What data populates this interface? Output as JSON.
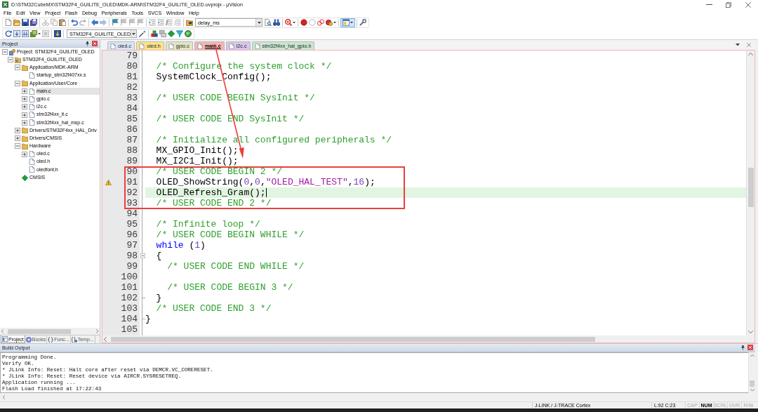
{
  "window": {
    "title": "D:\\STM32CubeMX\\STM32F4_GUILITE_OLED\\MDK-ARM\\STM32F4_GUILITE_OLED.uvprojx - µVision"
  },
  "menu": [
    "File",
    "Edit",
    "View",
    "Project",
    "Flash",
    "Debug",
    "Peripherals",
    "Tools",
    "SVCS",
    "Window",
    "Help"
  ],
  "toolbar": {
    "find_field": {
      "value": "delay_ms"
    },
    "target_select": {
      "value": "STM32F4_GUILITE_OLED"
    }
  },
  "project_panel": {
    "title": "Project",
    "tree": [
      {
        "label": "Project: STM32F4_GUILITE_OLED",
        "kind": "project",
        "expanded": true,
        "selected": false,
        "children": [
          {
            "label": "STM32F4_GUILITE_OLED",
            "kind": "target",
            "expanded": true,
            "selected": false,
            "children": [
              {
                "label": "Application/MDK-ARM",
                "kind": "group",
                "expanded": true,
                "selected": false,
                "children": [
                  {
                    "label": "startup_stm32f407xx.s",
                    "kind": "file",
                    "selected": false
                  }
                ]
              },
              {
                "label": "Application/User/Core",
                "kind": "group",
                "expanded": true,
                "selected": false,
                "children": [
                  {
                    "label": "main.c",
                    "kind": "file",
                    "expanded": false,
                    "selected": true
                  },
                  {
                    "label": "gpio.c",
                    "kind": "file",
                    "expanded": false,
                    "selected": false
                  },
                  {
                    "label": "i2c.c",
                    "kind": "file",
                    "expanded": false,
                    "selected": false
                  },
                  {
                    "label": "stm32f4xx_it.c",
                    "kind": "file",
                    "expanded": false,
                    "selected": false
                  },
                  {
                    "label": "stm32f4xx_hal_msp.c",
                    "kind": "file",
                    "expanded": false,
                    "selected": false
                  }
                ]
              },
              {
                "label": "Drivers/STM32F4xx_HAL_Driv",
                "kind": "group",
                "expanded": false,
                "selected": false
              },
              {
                "label": "Drivers/CMSIS",
                "kind": "group",
                "expanded": false,
                "selected": false
              },
              {
                "label": "Hardware",
                "kind": "group",
                "expanded": true,
                "selected": false,
                "children": [
                  {
                    "label": "oled.c",
                    "kind": "file",
                    "expanded": false,
                    "selected": false
                  },
                  {
                    "label": "oled.h",
                    "kind": "file",
                    "selected": false
                  },
                  {
                    "label": "oledfont.h",
                    "kind": "file",
                    "selected": false
                  }
                ]
              },
              {
                "label": "CMSIS",
                "kind": "component",
                "selected": false
              }
            ]
          }
        ]
      }
    ],
    "tabs": [
      {
        "label": "Project",
        "selected": true
      },
      {
        "label": "Books",
        "selected": false
      },
      {
        "label": "Func...",
        "selected": false
      },
      {
        "label": "Temp...",
        "selected": false
      }
    ]
  },
  "editor": {
    "tabs": [
      {
        "label": "oled.c",
        "color": "#d9e3f6",
        "selected": false
      },
      {
        "label": "oled.h",
        "color": "#fbe38c",
        "selected": false
      },
      {
        "label": "gpio.c",
        "color": "#e2e6c4",
        "selected": false
      },
      {
        "label": "main.c",
        "color": "#f4b6b4",
        "selected": true
      },
      {
        "label": "i2c.c",
        "color": "#d8c6ec",
        "selected": false
      },
      {
        "label": "stm32f4xx_hal_gpio.h",
        "color": "#c8e6d0",
        "selected": false
      }
    ],
    "lines": [
      {
        "number": "79",
        "kind": "line",
        "current": false,
        "warning": false
      },
      {
        "number": "80",
        "kind": "line",
        "current": false,
        "warning": false,
        "tokens": [
          {
            "kind": "comment",
            "text": "  /* Configure the system clock */"
          }
        ]
      },
      {
        "number": "81",
        "kind": "line",
        "current": false,
        "warning": false,
        "tokens": [
          {
            "kind": "plain",
            "text": "  SystemClock_Config();"
          }
        ]
      },
      {
        "number": "82",
        "kind": "line",
        "current": false,
        "warning": false
      },
      {
        "number": "83",
        "kind": "line",
        "current": false,
        "warning": false,
        "tokens": [
          {
            "kind": "comment",
            "text": "  /* USER CODE BEGIN SysInit */"
          }
        ]
      },
      {
        "number": "84",
        "kind": "line",
        "current": false,
        "warning": false
      },
      {
        "number": "85",
        "kind": "line",
        "current": false,
        "warning": false,
        "tokens": [
          {
            "kind": "comment",
            "text": "  /* USER CODE END SysInit */"
          }
        ]
      },
      {
        "number": "86",
        "kind": "line",
        "current": false,
        "warning": false
      },
      {
        "number": "87",
        "kind": "line",
        "current": false,
        "warning": false,
        "tokens": [
          {
            "kind": "comment",
            "text": "  /* Initialize all configured peripherals */"
          }
        ]
      },
      {
        "number": "88",
        "kind": "line",
        "current": false,
        "warning": false,
        "tokens": [
          {
            "kind": "plain",
            "text": "  MX_GPIO_Init();"
          }
        ]
      },
      {
        "number": "89",
        "kind": "line",
        "current": false,
        "warning": false,
        "tokens": [
          {
            "kind": "plain",
            "text": "  MX_I2C1_Init();"
          }
        ]
      },
      {
        "number": "90",
        "kind": "line",
        "current": false,
        "warning": false,
        "tokens": [
          {
            "kind": "comment",
            "text": "  /* USER CODE BEGIN 2 */"
          }
        ]
      },
      {
        "number": "91",
        "kind": "line",
        "current": false,
        "warning": true,
        "tokens": [
          {
            "kind": "plain",
            "text": "  OLED_ShowString("
          },
          {
            "kind": "number",
            "text": "0"
          },
          {
            "kind": "plain",
            "text": ","
          },
          {
            "kind": "number",
            "text": "0"
          },
          {
            "kind": "plain",
            "text": ","
          },
          {
            "kind": "string",
            "text": "\"OLED_HAL_TEST\""
          },
          {
            "kind": "plain",
            "text": ","
          },
          {
            "kind": "number",
            "text": "16"
          },
          {
            "kind": "plain",
            "text": ");"
          }
        ]
      },
      {
        "number": "92",
        "kind": "line",
        "current": true,
        "warning": false,
        "tokens": [
          {
            "kind": "plain",
            "text": "  OLED_Refresh_Gram();"
          }
        ]
      },
      {
        "number": "93",
        "kind": "line",
        "current": false,
        "warning": false,
        "tokens": [
          {
            "kind": "comment",
            "text": "  /* USER CODE END 2 */"
          }
        ]
      },
      {
        "number": "94",
        "kind": "line",
        "current": false,
        "warning": false
      },
      {
        "number": "95",
        "kind": "line",
        "current": false,
        "warning": false,
        "tokens": [
          {
            "kind": "comment",
            "text": "  /* Infinite loop */"
          }
        ]
      },
      {
        "number": "96",
        "kind": "line",
        "current": false,
        "warning": false,
        "tokens": [
          {
            "kind": "comment",
            "text": "  /* USER CODE BEGIN WHILE */"
          }
        ]
      },
      {
        "number": "97",
        "kind": "line",
        "current": false,
        "warning": false,
        "tokens": [
          {
            "kind": "keyword",
            "text": "  while"
          },
          {
            "kind": "plain",
            "text": " ("
          },
          {
            "kind": "number",
            "text": "1"
          },
          {
            "kind": "plain",
            "text": ")"
          }
        ]
      },
      {
        "number": "98",
        "kind": "opener",
        "current": false,
        "warning": false,
        "tokens": [
          {
            "kind": "plain",
            "text": "  {"
          }
        ]
      },
      {
        "number": "99",
        "kind": "line",
        "current": false,
        "warning": false,
        "tokens": [
          {
            "kind": "comment",
            "text": "    /* USER CODE END WHILE */"
          }
        ]
      },
      {
        "number": "100",
        "kind": "line",
        "current": false,
        "warning": false
      },
      {
        "number": "101",
        "kind": "line",
        "current": false,
        "warning": false,
        "tokens": [
          {
            "kind": "comment",
            "text": "    /* USER CODE BEGIN 3 */"
          }
        ]
      },
      {
        "number": "102",
        "kind": "closer",
        "current": false,
        "warning": false,
        "tokens": [
          {
            "kind": "plain",
            "text": "  }"
          }
        ]
      },
      {
        "number": "103",
        "kind": "line",
        "current": false,
        "warning": false,
        "tokens": [
          {
            "kind": "comment",
            "text": "  /* USER CODE END 3 */"
          }
        ]
      },
      {
        "number": "104",
        "kind": "closer",
        "current": false,
        "warning": false,
        "tokens": [
          {
            "kind": "plain",
            "text": "}"
          }
        ]
      },
      {
        "number": "105",
        "kind": "line",
        "current": false,
        "warning": false
      }
    ]
  },
  "build_output": {
    "title": "Build Output",
    "lines": [
      "Programming Done.",
      "Verify OK.",
      "* JLink Info: Reset: Halt core after reset via DEMCR.VC_CORERESET.",
      "* JLink Info: Reset: Reset device via AIRCR.SYSRESETREQ.",
      "Application running ...",
      "Flash Load finished at 17:22:43"
    ]
  },
  "status_bar": {
    "debugger": "J-LINK / J-TRACE Cortex",
    "cursor": "L:92 C:23",
    "indicators": [
      {
        "label": "CAP",
        "on": false
      },
      {
        "label": "NUM",
        "on": true
      },
      {
        "label": "SCRL",
        "on": false
      },
      {
        "label": "OVR",
        "on": false
      },
      {
        "label": "R/W",
        "on": false
      }
    ]
  }
}
